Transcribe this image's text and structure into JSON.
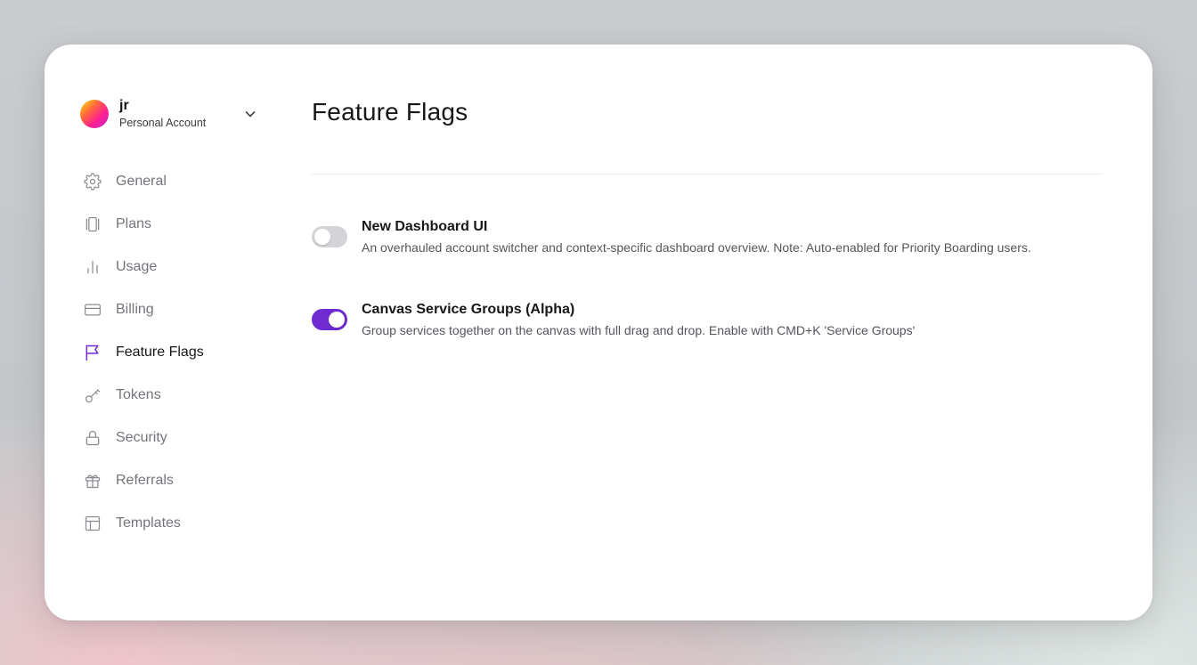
{
  "account": {
    "name": "jr",
    "type": "Personal Account"
  },
  "sidebar": {
    "items": [
      {
        "label": "General",
        "icon": "gear-icon",
        "active": false
      },
      {
        "label": "Plans",
        "icon": "plans-icon",
        "active": false
      },
      {
        "label": "Usage",
        "icon": "bar-chart-icon",
        "active": false
      },
      {
        "label": "Billing",
        "icon": "credit-card-icon",
        "active": false
      },
      {
        "label": "Feature Flags",
        "icon": "flag-icon",
        "active": true
      },
      {
        "label": "Tokens",
        "icon": "key-icon",
        "active": false
      },
      {
        "label": "Security",
        "icon": "lock-icon",
        "active": false
      },
      {
        "label": "Referrals",
        "icon": "gift-icon",
        "active": false
      },
      {
        "label": "Templates",
        "icon": "template-icon",
        "active": false
      }
    ]
  },
  "main": {
    "title": "Feature Flags",
    "flags": [
      {
        "title": "New Dashboard UI",
        "description": "An overhauled account switcher and context-specific dashboard overview. Note: Auto-enabled for Priority Boarding users.",
        "enabled": false
      },
      {
        "title": "Canvas Service Groups (Alpha)",
        "description": "Group services together on the canvas with full drag and drop. Enable with CMD+K 'Service Groups'",
        "enabled": true
      }
    ]
  },
  "colors": {
    "accent": "#6f2bd1",
    "toggle_off": "#d4d4d8",
    "muted_text": "#74757a"
  }
}
